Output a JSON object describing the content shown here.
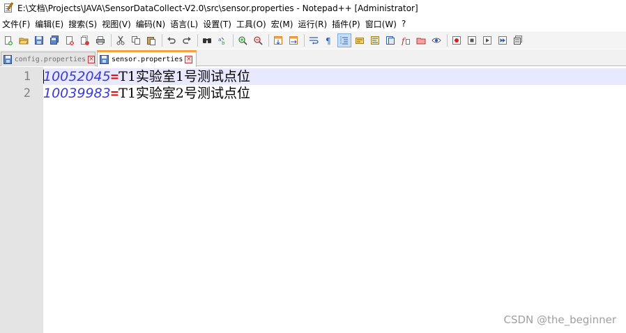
{
  "window": {
    "title": "E:\\文档\\Projects\\JAVA\\SensorDataCollect-V2.0\\src\\sensor.properties - Notepad++ [Administrator]"
  },
  "menu": [
    {
      "label": "文件(F)"
    },
    {
      "label": "编辑(E)"
    },
    {
      "label": "搜索(S)"
    },
    {
      "label": "视图(V)"
    },
    {
      "label": "编码(N)"
    },
    {
      "label": "语言(L)"
    },
    {
      "label": "设置(T)"
    },
    {
      "label": "工具(O)"
    },
    {
      "label": "宏(M)"
    },
    {
      "label": "运行(R)"
    },
    {
      "label": "插件(P)"
    },
    {
      "label": "窗口(W)"
    },
    {
      "label": "?"
    }
  ],
  "toolbar": {
    "icons": [
      "new-file-icon",
      "open-file-icon",
      "save-icon",
      "save-all-icon",
      "close-icon",
      "close-all-icon",
      "print-icon",
      "cut-icon",
      "copy-icon",
      "paste-icon",
      "undo-icon",
      "redo-icon",
      "find-icon",
      "replace-icon",
      "zoom-in-icon",
      "zoom-out-icon",
      "sync-vertical-icon",
      "sync-horizontal-icon",
      "word-wrap-icon",
      "show-all-chars-icon",
      "indent-guide-icon",
      "udl-icon",
      "doc-map-icon",
      "function-list-icon",
      "folder-workspace-icon",
      "monitoring-icon",
      "record-macro-icon",
      "stop-record-icon",
      "play-macro-icon",
      "run-macro-multiple-icon",
      "save-macro-icon"
    ],
    "active_icon": "indent-guide-icon"
  },
  "tabs": [
    {
      "label": "config.properties",
      "active": false
    },
    {
      "label": "sensor.properties",
      "active": true
    }
  ],
  "editor": {
    "lines": [
      {
        "number": "1",
        "key": "10052045",
        "sep": "=",
        "value": "T1实验室1号测试点位",
        "current": true
      },
      {
        "number": "2",
        "key": "10039983",
        "sep": "=",
        "value": "T1实验室2号测试点位",
        "current": false
      }
    ]
  },
  "watermark": "CSDN @the_beginner",
  "colors": {
    "key": "#3b3bd9",
    "separator": "#e01010",
    "current_line": "#e8e8ff",
    "gutter": "#e4e4e4",
    "active_tab_accent": "#f8a23c"
  }
}
